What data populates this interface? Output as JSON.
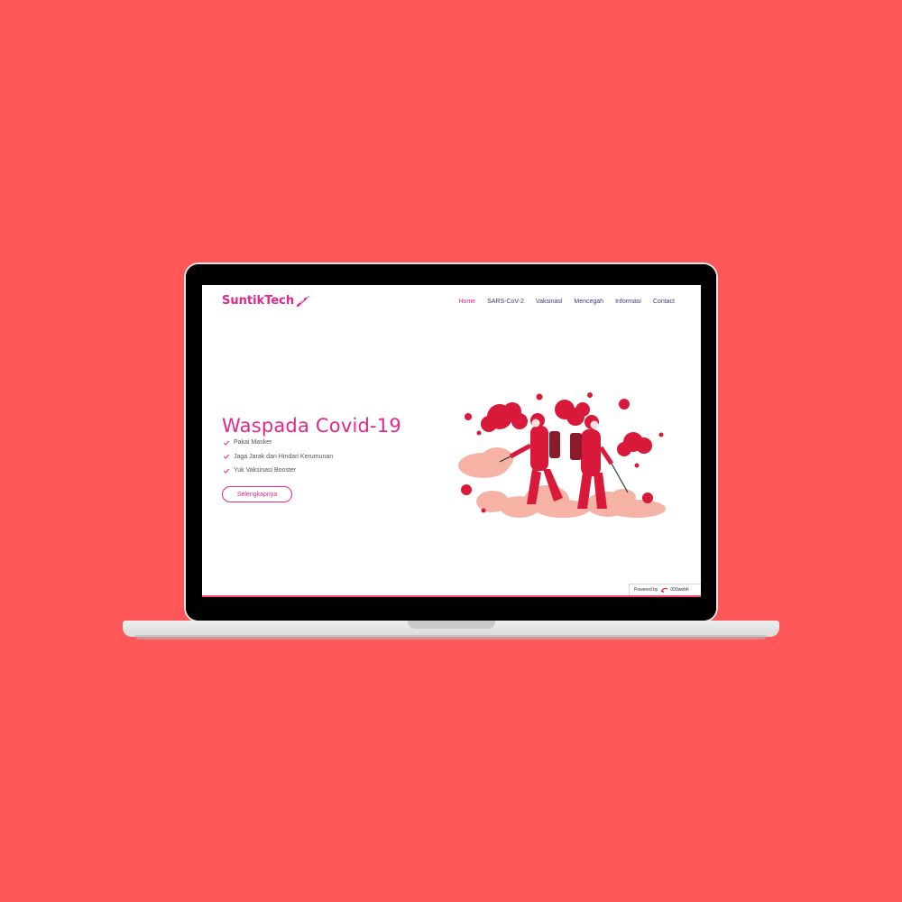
{
  "site": {
    "logo_text": "SuntikTech",
    "logo_icon": "syringe-icon",
    "brand_color": "#e2288a"
  },
  "nav": {
    "items": [
      {
        "label": "Home",
        "active": true
      },
      {
        "label": "SARS-CoV-2",
        "active": false
      },
      {
        "label": "Vaksinasi",
        "active": false
      },
      {
        "label": "Mencegah",
        "active": false
      },
      {
        "label": "Informasi",
        "active": false
      },
      {
        "label": "Contact",
        "active": false
      }
    ]
  },
  "hero": {
    "title": "Waspada Covid-19",
    "checklist": [
      "Pakai Masker",
      "Jaga Jarak dan Hindari Kerumunan",
      "Yuk Vaksinasi Booster"
    ],
    "cta_label": "Selengkapnya",
    "illustration": "disinfection-workers-illustration"
  },
  "footer_badge": {
    "powered_label": "Powered by",
    "host_name": "000webh"
  },
  "colors": {
    "background": "#FF5757",
    "accent": "#e2288a",
    "nav_text": "#3c3c6e"
  }
}
